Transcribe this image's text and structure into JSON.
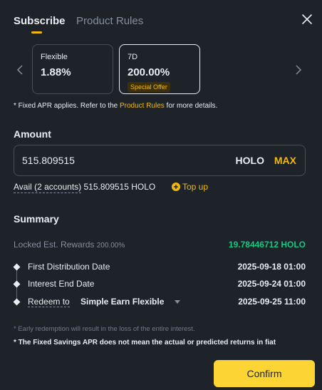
{
  "tabs": [
    {
      "label": "Subscribe",
      "active": true
    },
    {
      "label": "Product Rules",
      "active": false
    }
  ],
  "terms": [
    {
      "name": "Flexible",
      "apr": "1.88%",
      "badge": "",
      "selected": false
    },
    {
      "name": "7D",
      "apr": "200.00%",
      "badge": "Special Offer",
      "selected": true
    }
  ],
  "note": {
    "prefix": "* Fixed APR applies. Refer to the ",
    "link": "Product Rules",
    "suffix": " for more details."
  },
  "amount": {
    "title": "Amount",
    "value": "515.809515",
    "asset": "HOLO",
    "max_label": "MAX"
  },
  "avail": {
    "label": "Avail (2 accounts)",
    "value": "515.809515 HOLO",
    "topup_label": "Top up"
  },
  "summary": {
    "title": "Summary",
    "rewards_label": "Locked Est. Rewards",
    "rewards_apr": "200.00%",
    "rewards_value": "19.78446712 HOLO",
    "first_distribution_label": "First Distribution Date",
    "first_distribution_value": "2025-09-18 01:00",
    "interest_end_label": "Interest End Date",
    "interest_end_value": "2025-09-24 01:00",
    "redeem_label": "Redeem to",
    "redeem_option": "Simple Earn Flexible",
    "redeem_value": "2025-09-25 11:00"
  },
  "footnotes": {
    "early_redemption": "* Early redemption will result in the loss of the entire interest.",
    "apr_disclaimer": "* The Fixed Savings APR does not mean the actual or predicted returns in fiat"
  },
  "confirm_label": "Confirm",
  "colors": {
    "background": "#1e2329",
    "accent": "#f0b90b",
    "button": "#fcd535",
    "positive": "#0ecb81"
  }
}
